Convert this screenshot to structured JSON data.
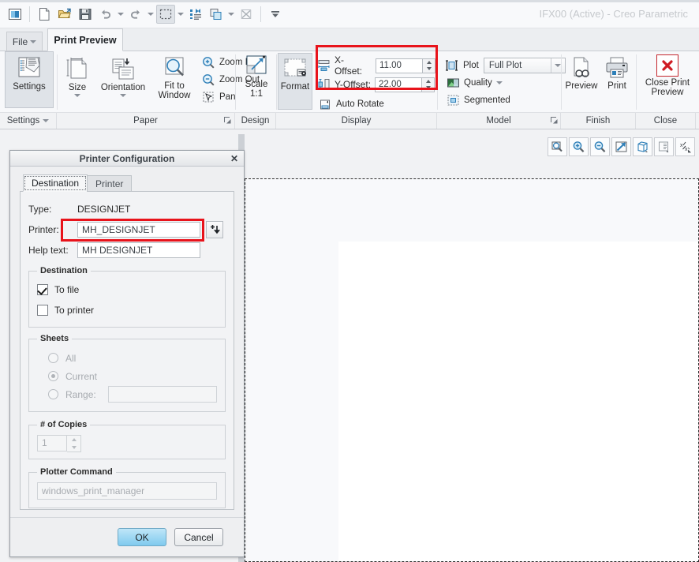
{
  "window": {
    "title": "IFX00 (Active) - Creo Parametric"
  },
  "quick_access": {
    "items": [
      {
        "name": "app-menu-icon",
        "label": "Creo"
      },
      {
        "name": "new-icon",
        "label": "New"
      },
      {
        "name": "open-icon",
        "label": "Open"
      },
      {
        "name": "save-icon",
        "label": "Save"
      },
      {
        "name": "undo-icon",
        "label": "Undo"
      },
      {
        "name": "redo-icon",
        "label": "Redo"
      },
      {
        "name": "select-icon",
        "label": "Select"
      },
      {
        "name": "regenerate-icon",
        "label": "Regenerate"
      },
      {
        "name": "window-icon",
        "label": "Window"
      },
      {
        "name": "close-window-icon",
        "label": "Close"
      },
      {
        "name": "qat-overflow-icon",
        "label": "Customize Quick Access Toolbar"
      }
    ]
  },
  "tabs": {
    "file_label": "File",
    "active_tab": "Print Preview"
  },
  "ribbon": {
    "settings": {
      "button_label": "Settings",
      "group_label": "Settings"
    },
    "paper": {
      "size_label": "Size",
      "orientation_label": "Orientation",
      "fit_to_window_label": "Fit to Window",
      "zoom_in_label": "Zoom In",
      "zoom_out_label": "Zoom Out",
      "pan_label": "Pan",
      "group_label": "Paper"
    },
    "design": {
      "scale_label": "Scale 1:1",
      "group_label": "Design"
    },
    "display": {
      "format_label": "Format",
      "x_offset_label": "X-Offset:",
      "x_offset_value": "11.00",
      "y_offset_label": "Y-Offset:",
      "y_offset_value": "22.00",
      "auto_rotate_label": "Auto Rotate",
      "group_label": "Display"
    },
    "model": {
      "plot_label": "Plot",
      "plot_value": "Full Plot",
      "quality_label": "Quality",
      "segmented_label": "Segmented",
      "group_label": "Model"
    },
    "finish": {
      "preview_label": "Preview",
      "print_label": "Print",
      "group_label": "Finish"
    },
    "close": {
      "close_print_preview_label": "Close Print Preview",
      "group_label": "Close"
    }
  },
  "graphics_toolbar": {
    "buttons": [
      {
        "name": "refit-icon",
        "label": "Refit"
      },
      {
        "name": "zoom-in-icon",
        "label": "Zoom In"
      },
      {
        "name": "zoom-out-icon",
        "label": "Zoom Out"
      },
      {
        "name": "repaint-icon",
        "label": "Repaint"
      },
      {
        "name": "display-style-icon",
        "label": "Display Style"
      },
      {
        "name": "saved-orientations-icon",
        "label": "Saved Orientations"
      },
      {
        "name": "datum-display-icon",
        "label": "Datum Display Filters"
      }
    ]
  },
  "dialog": {
    "title": "Printer Configuration",
    "close_label": "✕",
    "tabs": [
      {
        "label": "Destination",
        "active": true
      },
      {
        "label": "Printer",
        "active": false
      }
    ],
    "type_label": "Type:",
    "type_value": "DESIGNJET",
    "printer_label": "Printer:",
    "printer_value": "MH_DESIGNJET",
    "printer_browse_label": "Add printer",
    "help_text_label": "Help text:",
    "help_text_value": "MH DESIGNJET",
    "destination": {
      "legend": "Destination",
      "to_file_label": "To file",
      "to_file_checked": true,
      "to_printer_label": "To printer",
      "to_printer_checked": false
    },
    "sheets": {
      "legend": "Sheets",
      "all_label": "All",
      "current_label": "Current",
      "range_label": "Range:",
      "range_value": "",
      "selected": "Current"
    },
    "copies": {
      "legend": "# of Copies",
      "value": "1"
    },
    "plotter_command": {
      "legend": "Plotter Command",
      "value": "windows_print_manager"
    },
    "ok_label": "OK",
    "cancel_label": "Cancel"
  },
  "highlights": {
    "accent_color": "#e8131b",
    "regions": [
      {
        "name": "offset-fields-highlight"
      },
      {
        "name": "printer-field-highlight"
      }
    ]
  }
}
